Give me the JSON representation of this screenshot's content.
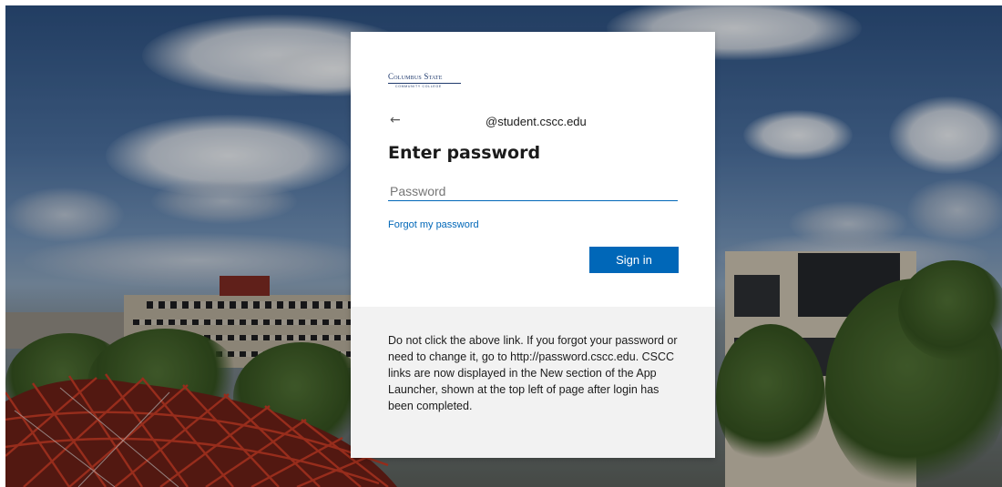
{
  "branding": {
    "logo_line1": "Columbus State",
    "logo_line2": "COMMUNITY COLLEGE"
  },
  "card": {
    "back_arrow": "←",
    "identity": "@student.cscc.edu",
    "title": "Enter password",
    "password_value": "",
    "password_placeholder": "Password",
    "forgot_link": "Forgot my password",
    "signin_button": "Sign in"
  },
  "footer": {
    "notice": "Do not click the above link. If you forgot your password or need to change it, go to http://password.cscc.edu. CSCC links are now displayed in the New section of the App Launcher, shown at the top left of page after login has been completed."
  },
  "colors": {
    "accent": "#0067b8",
    "footer_background": "#f2f2f2",
    "logo_navy": "#1f3a6d"
  },
  "icons": {
    "back": "arrow-left-icon"
  }
}
